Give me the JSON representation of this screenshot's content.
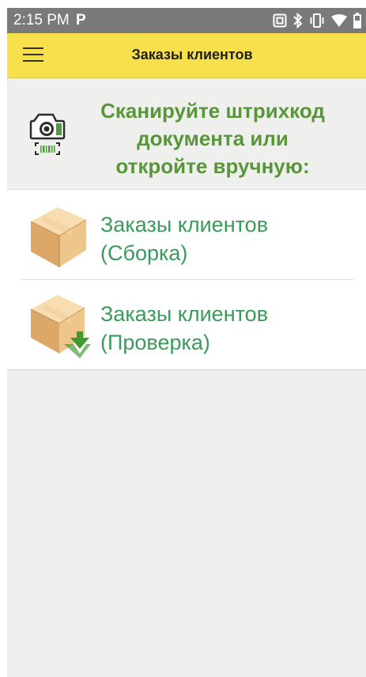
{
  "status_bar": {
    "time": "2:15 PM",
    "app_glyph": "P",
    "icons": [
      "nfc-icon",
      "bluetooth-icon",
      "vibrate-icon",
      "wifi-icon",
      "battery-icon"
    ]
  },
  "app_bar": {
    "title": "Заказы клиентов",
    "menu_icon": "hamburger-menu-icon"
  },
  "scan_prompt": {
    "line1": "Сканируйте штрихкод",
    "line2": "документа или",
    "line3": "откройте вручную:",
    "icon": "camera-barcode-icon"
  },
  "menu": {
    "items": [
      {
        "line1": "Заказы клиентов",
        "line2": "(Сборка)",
        "icon": "box-icon"
      },
      {
        "line1": "Заказы клиентов",
        "line2": "(Проверка)",
        "icon": "box-download-icon"
      }
    ]
  },
  "colors": {
    "status_bar": "#7a7a78",
    "app_bar": "#f8e04c",
    "prompt_text": "#58963a",
    "item_text": "#3a9a5a",
    "background": "#efefed"
  }
}
